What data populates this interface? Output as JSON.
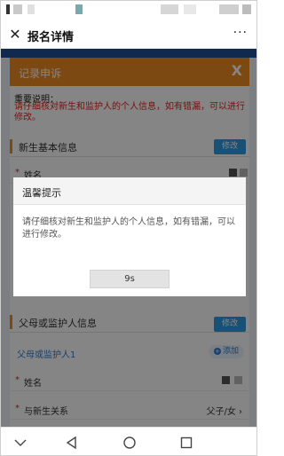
{
  "header": {
    "title": "报名详情",
    "close_icon": "close-icon",
    "more_icon": "more-dots-icon",
    "more_label": "···"
  },
  "dialog": {
    "title": "记录申诉",
    "close_label": "X",
    "note_label": "重要说明：",
    "note_text": "请仔细核对新生和监护人的个人信息，如有错漏，可以进行修改。",
    "note_color": "#e8211d",
    "accent_color": "#f08d24",
    "sections": [
      {
        "title": "新生基本信息",
        "edit_label": "修改"
      },
      {
        "title": "父母或监护人信息",
        "edit_label": "修改"
      }
    ],
    "student_fields": [
      {
        "label": "姓名",
        "required": "*"
      }
    ],
    "guardian": {
      "subtitle": "父母或监护人1",
      "add_label": "添加",
      "fields": [
        {
          "label": "姓名",
          "required": "*",
          "value": ""
        },
        {
          "label": "与新生关系",
          "required": "*",
          "value": "父子/女 ›"
        }
      ]
    }
  },
  "modal": {
    "title": "温馨提示",
    "message": "请仔细核对新生和监护人的个人信息，如有错漏，可以进行修改。",
    "countdown": "9s"
  },
  "navbar": {
    "icons": [
      "chevron-down-icon",
      "back-triangle-icon",
      "home-circle-icon",
      "recents-square-icon"
    ]
  }
}
